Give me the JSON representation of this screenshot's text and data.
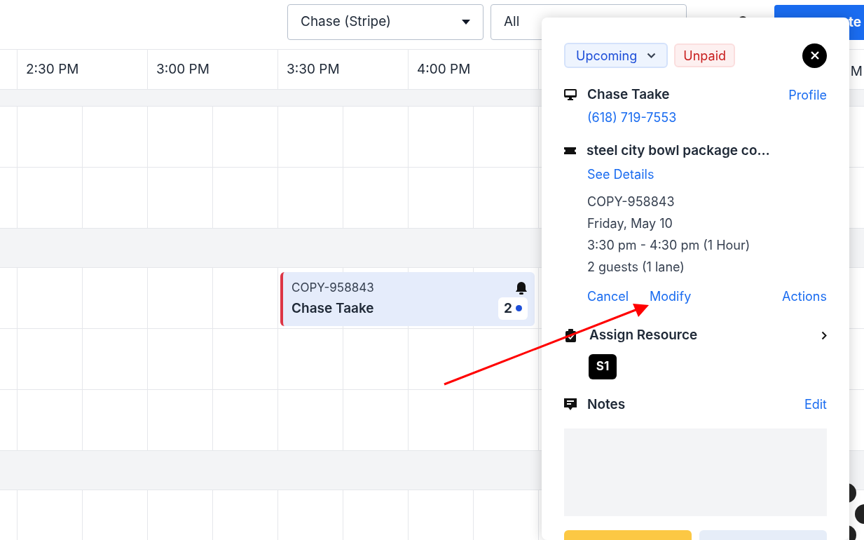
{
  "toolbar": {
    "location_select": "Chase (Stripe)",
    "filter_select": "All",
    "create_button": "te"
  },
  "time_header": [
    "2:30 PM",
    "3:00 PM",
    "3:30 PM",
    "4:00 PM"
  ],
  "time_header_cut": "M",
  "rows": [
    {
      "kind": "band-top"
    },
    {
      "kind": "slot"
    },
    {
      "kind": "slot"
    },
    {
      "kind": "band"
    },
    {
      "kind": "slot",
      "event": {
        "code": "COPY-958843",
        "name": "Chase Taake",
        "guests": "2",
        "color": "#dc3545"
      }
    },
    {
      "kind": "slot"
    },
    {
      "kind": "slot"
    },
    {
      "kind": "band"
    },
    {
      "kind": "slot"
    }
  ],
  "booking_panel": {
    "status": "Upcoming",
    "payment": "Unpaid",
    "customer": {
      "name": "Chase Taake",
      "phone": "(618) 719-7553",
      "link": "Profile"
    },
    "package": {
      "title": "steel city bowl package co…",
      "link": "See Details"
    },
    "details": [
      "COPY-958843",
      "Friday, May 10",
      "3:30 pm - 4:30 pm (1 Hour)",
      "2 guests (1 lane)"
    ],
    "actions": [
      "Cancel",
      "Modify",
      "Actions"
    ],
    "resource": {
      "title": "Assign Resource",
      "chips": [
        "S1"
      ]
    },
    "notes": {
      "title": "Notes",
      "link": "Edit"
    },
    "footer_buttons": [
      {
        "kind": "primary"
      },
      {
        "kind": "secondary"
      }
    ]
  }
}
